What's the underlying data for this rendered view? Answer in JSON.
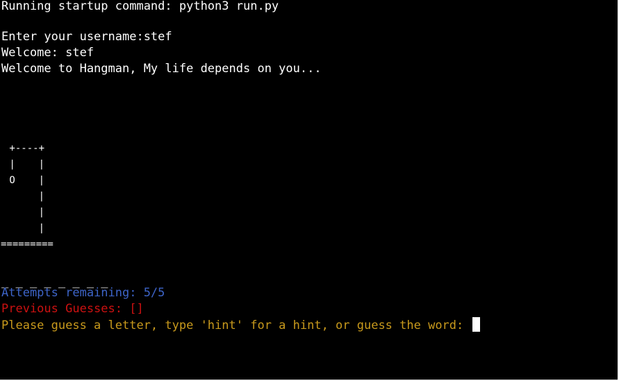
{
  "terminal": {
    "startup_line": "Running startup command: python3 run.py",
    "username_prompt": "Enter your username:stef",
    "welcome_user": "Welcome: stef",
    "welcome_game": "Welcome to Hangman, My life depends on you...",
    "gallows": [
      " +----+",
      " |    |",
      " O    |",
      "      |",
      "      |",
      "      |",
      "========="
    ],
    "word_blanks": "_ _ _ _ _ _ _ _",
    "attempts_remaining": "Attempts remaining: 5/5",
    "previous_guesses": "Previous Guesses: []",
    "guess_prompt": "Please guess a letter, type 'hint' for a hint, or guess the word: "
  },
  "colors": {
    "background": "#000000",
    "text": "#ffffff",
    "attempts": "#3d64c8",
    "guesses": "#cc1111",
    "prompt": "#c99a1c"
  }
}
